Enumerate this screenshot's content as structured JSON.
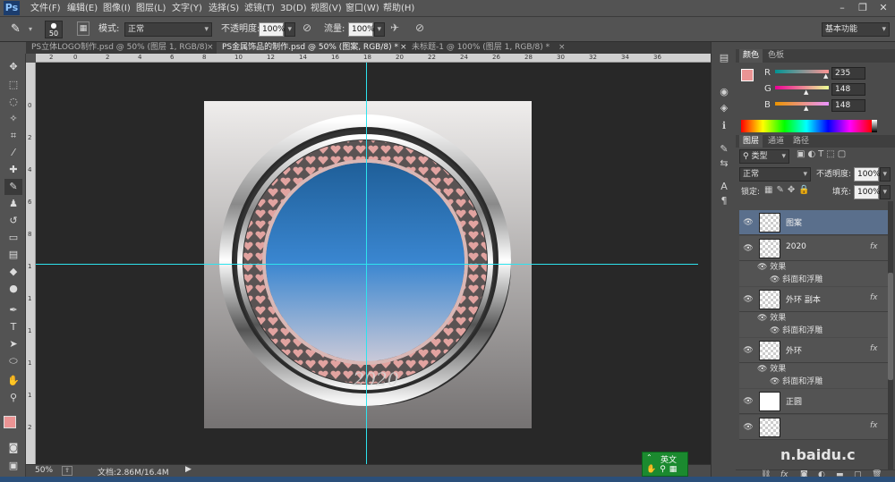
{
  "menu": {
    "logo": "Ps",
    "items": [
      "文件(F)",
      "编辑(E)",
      "图像(I)",
      "图层(L)",
      "文字(Y)",
      "选择(S)",
      "滤镜(T)",
      "3D(D)",
      "视图(V)",
      "窗口(W)",
      "帮助(H)"
    ]
  },
  "options": {
    "brush_size": "50",
    "mode_label": "模式:",
    "mode_value": "正常",
    "opacity_label": "不透明度:",
    "opacity_value": "100%",
    "flow_label": "流量:",
    "flow_value": "100%",
    "workspace": "基本功能"
  },
  "tabs": [
    "PS立体LOGO制作.psd @ 50% (图层 1, RGB/8) *",
    "PS金属饰品的制作.psd @ 50% (图案, RGB/8) *",
    "未标题-1 @ 100% (图层 1, RGB/8) *"
  ],
  "ruler_top": [
    "2",
    "0",
    "2",
    "4",
    "6",
    "8",
    "10",
    "12",
    "14",
    "16",
    "18",
    "20",
    "22",
    "24",
    "26",
    "28",
    "30",
    "32",
    "34",
    "36"
  ],
  "ruler_left": [
    "0",
    "2",
    "4",
    "6",
    "8",
    "1",
    "1",
    "1",
    "1",
    "1",
    "2"
  ],
  "status": {
    "zoom": "50%",
    "doc": "文档:2.86M/16.4M"
  },
  "color_panel": {
    "tabs": [
      "颜色",
      "色板"
    ],
    "r_label": "R",
    "g_label": "G",
    "b_label": "B",
    "r": "235",
    "g": "148",
    "b": "148",
    "foreground": "#eb9494"
  },
  "layers_panel": {
    "tabs": [
      "图层",
      "通道",
      "路径"
    ],
    "filter": "类型",
    "blend": "正常",
    "opacity_label": "不透明度:",
    "opacity": "100%",
    "lock_label": "锁定:",
    "fill_label": "填充:",
    "fill": "100%",
    "layers": [
      {
        "name": "图案",
        "fx": "",
        "selected": true
      },
      {
        "name": "2020",
        "fx": "fx",
        "selected": false,
        "effects": [
          "效果",
          "斜面和浮雕"
        ]
      },
      {
        "name": "外环 副本",
        "fx": "fx",
        "selected": false,
        "effects": [
          "效果",
          "斜面和浮雕"
        ]
      },
      {
        "name": "外环",
        "fx": "fx",
        "selected": false,
        "effects": [
          "效果",
          "斜面和浮雕"
        ]
      },
      {
        "name": "正圆",
        "fx": "",
        "selected": false
      },
      {
        "name": "",
        "fx": "fx",
        "selected": false
      }
    ]
  },
  "ime": {
    "label": "英文"
  },
  "watermark": "n.baidu.c",
  "canvas": {
    "ring_text": "2020"
  }
}
